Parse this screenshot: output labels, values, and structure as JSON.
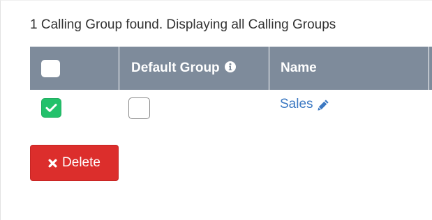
{
  "summary": {
    "text": "1 Calling Group found. Displaying all Calling Groups"
  },
  "table": {
    "columns": {
      "select": "",
      "default_group": "Default Group",
      "name": "Name"
    },
    "rows": [
      {
        "selected": true,
        "default_group": false,
        "name": "Sales"
      }
    ]
  },
  "actions": {
    "delete_label": "Delete"
  },
  "icons": {
    "info": "info-circle-icon",
    "edit": "pencil-icon",
    "delete": "times-icon",
    "checked": "checkmark-icon"
  },
  "colors": {
    "header_bg": "#7e8b9b",
    "checkbox_checked": "#23c16b",
    "link": "#3b78c2",
    "delete_bg": "#dc2e2c"
  }
}
